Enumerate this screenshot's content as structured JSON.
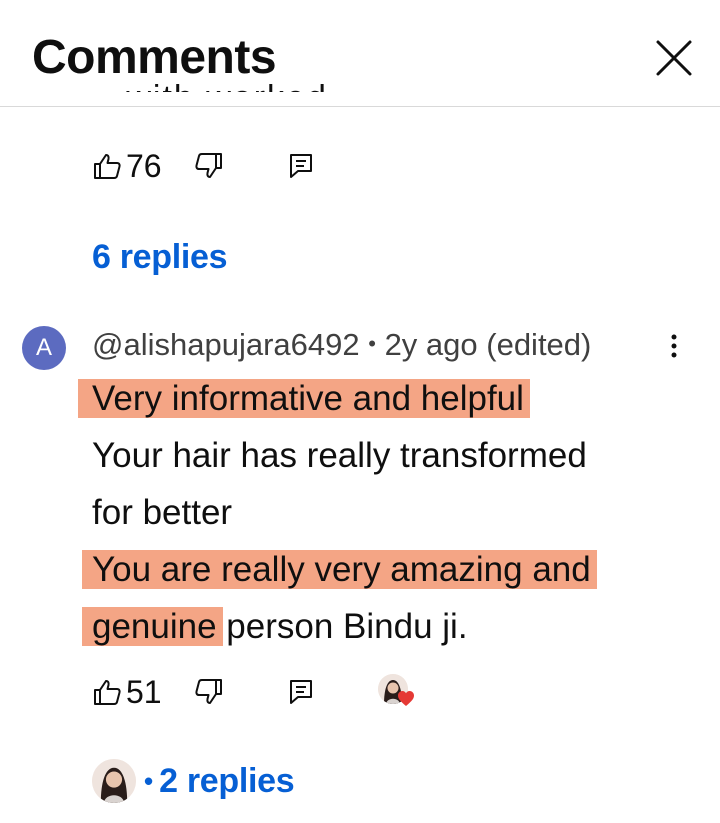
{
  "header": {
    "title": "Comments",
    "close_label": "close"
  },
  "previous_comment": {
    "cut_text": "...with worked",
    "likes": "76",
    "replies_label": "6 replies"
  },
  "comment": {
    "avatar_letter": "A",
    "author": "@alishapujara6492",
    "separator": "•",
    "meta": "2y ago (edited)",
    "lines": [
      "Very informative and helpful",
      "Your hair has really transformed",
      "for better",
      "You are really very amazing and",
      "genuine",
      " person Bindu ji."
    ],
    "likes": "51",
    "replies_label": "2 replies",
    "replies_separator": "•"
  },
  "colors": {
    "link": "#065fd4",
    "highlight": "#f4a585",
    "avatar": "#5c6bc0",
    "heart": "#e53935"
  },
  "icons": [
    "close-icon",
    "thumbs-up-icon",
    "thumbs-down-icon",
    "reply-icon",
    "more-vert-icon",
    "heart-icon"
  ]
}
